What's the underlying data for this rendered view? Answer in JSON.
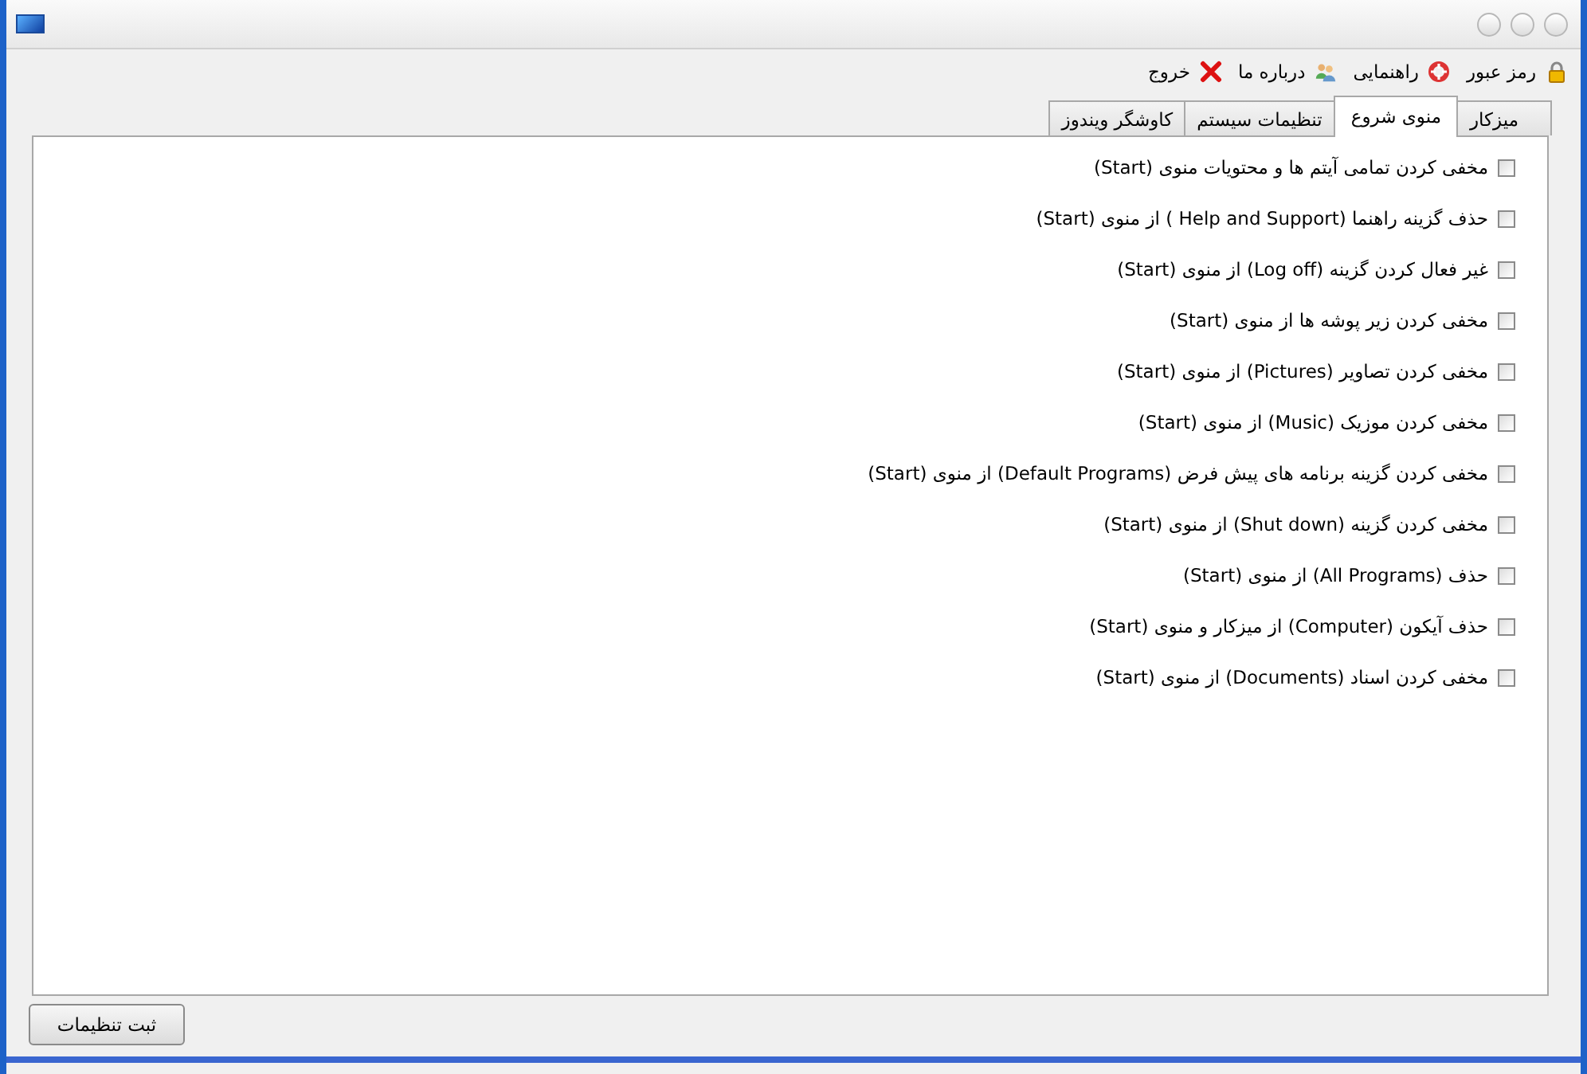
{
  "menu": [
    {
      "kind": "lock",
      "label": "رمز عبور"
    },
    {
      "kind": "help",
      "label": "راهنمایی"
    },
    {
      "kind": "people",
      "label": "درباره ما"
    },
    {
      "kind": "exit",
      "label": "خروج"
    }
  ],
  "tabs": [
    {
      "label": "میزکار",
      "selected": false
    },
    {
      "label": "منوی شروع",
      "selected": true
    },
    {
      "label": "تنظیمات سیستم",
      "selected": false
    },
    {
      "label": "کاوشگر ویندوز",
      "selected": false
    }
  ],
  "options": [
    {
      "label": "مخفی کردن تمامی آیتم ها و محتویات منوی (Start)",
      "checked": false
    },
    {
      "label": "حذف گزینه راهنما (Help and Support ) از منوی (Start)",
      "checked": false
    },
    {
      "label": "غیر فعال کردن گزینه (Log off) از منوی (Start)",
      "checked": false
    },
    {
      "label": "مخفی کردن زیر پوشه ها از منوی (Start)",
      "checked": false
    },
    {
      "label": "مخفی کردن تصاویر (Pictures) از منوی (Start)",
      "checked": false
    },
    {
      "label": "مخفی کردن موزیک (Music) از منوی (Start)",
      "checked": false
    },
    {
      "label": "مخفی کردن گزینه برنامه های پیش فرض (Default Programs) از منوی (Start)",
      "checked": false
    },
    {
      "label": "مخفی کردن گزینه (Shut down) از منوی (Start)",
      "checked": false
    },
    {
      "label": "حذف (All Programs)  از منوی (Start)",
      "checked": false
    },
    {
      "label": "حذف آیکون (Computer) از میزکار و منوی (Start)",
      "checked": false
    },
    {
      "label": "مخفی کردن اسناد  (Documents) از منوی  (Start)",
      "checked": false
    }
  ],
  "save_button": "ثبت تنظیمات"
}
